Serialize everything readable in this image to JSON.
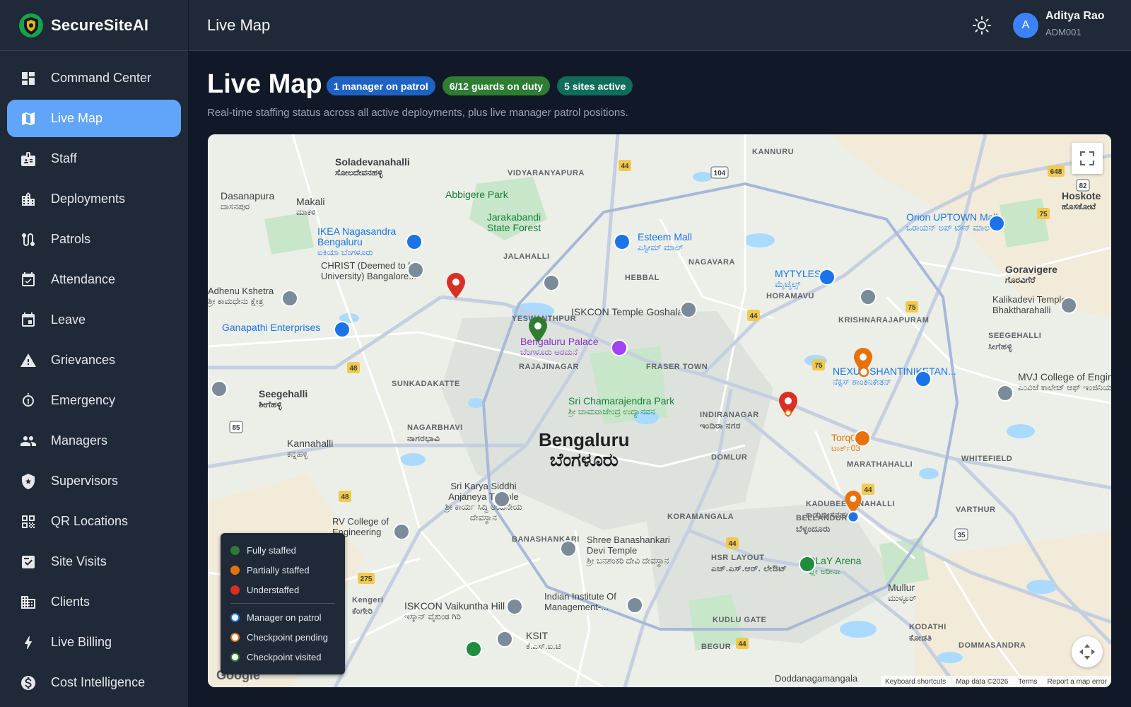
{
  "app": {
    "name": "SecureSiteAI"
  },
  "sidebar": {
    "items": [
      {
        "label": "Command Center",
        "icon": "dashboard-icon"
      },
      {
        "label": "Live Map",
        "icon": "map-icon",
        "active": true
      },
      {
        "label": "Staff",
        "icon": "badge-icon"
      },
      {
        "label": "Deployments",
        "icon": "building-icon"
      },
      {
        "label": "Patrols",
        "icon": "route-icon"
      },
      {
        "label": "Attendance",
        "icon": "calendar-check-icon"
      },
      {
        "label": "Leave",
        "icon": "calendar-icon"
      },
      {
        "label": "Grievances",
        "icon": "warning-icon"
      },
      {
        "label": "Emergency",
        "icon": "alarm-icon"
      },
      {
        "label": "Managers",
        "icon": "people-icon"
      },
      {
        "label": "Supervisors",
        "icon": "shield-star-icon"
      },
      {
        "label": "QR Locations",
        "icon": "qr-code-icon"
      },
      {
        "label": "Site Visits",
        "icon": "checklist-icon"
      },
      {
        "label": "Clients",
        "icon": "corporate-icon"
      },
      {
        "label": "Live Billing",
        "icon": "bolt-icon"
      },
      {
        "label": "Cost Intelligence",
        "icon": "dollar-icon"
      }
    ]
  },
  "topbar": {
    "title": "Live Map",
    "user": {
      "initial": "A",
      "name": "Aditya Rao",
      "id": "ADM001"
    }
  },
  "page": {
    "title": "Live Map",
    "badges": [
      "1 manager on patrol",
      "6/12 guards on duty",
      "5 sites active"
    ],
    "subtitle": "Real-time staffing status across all active deployments, plus live manager patrol positions."
  },
  "map": {
    "city_label": "Bengaluru",
    "city_label_kn": "ಬೆಂಗಳೂರು",
    "places": [
      {
        "en": "Soladevanahalli",
        "kn": "ಸೋಲದೇವನಹಳ್ಳಿ"
      },
      {
        "en": "Dasanapura",
        "kn": "ದಾಸನಪುರ"
      },
      {
        "en": "Makali",
        "kn": "ಮಾಕಳಿ"
      },
      {
        "en": "Abbigere Park"
      },
      {
        "en": "Jarakabandi State Forest"
      },
      {
        "en": "IKEA Nagasandra Bengaluru",
        "kn": "ಐಕಿಯಾ ಬೆಂಗಳೂರು"
      },
      {
        "en": "CHRIST (Deemed to be University) Bangalore..."
      },
      {
        "en": "Esteem Mall",
        "kn": "ಎಸ್ಟೀಮ್ ಮಾಲ್"
      },
      {
        "en": "ISKCON Temple Goshala"
      },
      {
        "en": "MYTYLES",
        "kn": "ಮೈಟೈಲ್ಸ್"
      },
      {
        "en": "Orion UPTOWN Mall",
        "kn": "ಒರಾಯನ್ ಅಪ್ ಟೌನ್ ಮಾಲ್"
      },
      {
        "en": "Goravigere",
        "kn": "ಗೊರವಿಗೆರೆ"
      },
      {
        "en": "Kalikadevi Temple Bhaktharahalli"
      },
      {
        "en": "Ganapathi Enterprises"
      },
      {
        "en": "Bengaluru Palace",
        "kn": "ಬೆಂಗಳೂರು ಅರಮನೆ"
      },
      {
        "en": "SEEGEHALLI",
        "kn": "ಸೀಗೆಹಳ್ಳಿ"
      },
      {
        "en": "NEXUS SHANTINIKETAN...",
        "kn": "ನೆಕ್ಸಸ್ ಶಾಂತಿನಿಕೇತನ್"
      },
      {
        "en": "MVJ College of Engineering",
        "kn": "ಎಂವಿಜೆ ಕಾಲೇಜ್ ಆಫ್ ಇಂಜಿನಿಯರಿಂಗ್"
      },
      {
        "en": "Seegehalli",
        "kn": "ಶೀಗೆಹಳ್ಳಿ"
      },
      {
        "en": "Sri Chamarajendra Park",
        "kn": "ಶ್ರೀ ಚಾಮರಾಜೇಂದ್ರ ಉದ್ಯಾನವನ"
      },
      {
        "en": "INDIRANAGAR",
        "kn": "ಇಂದಿರಾ ನಗರ"
      },
      {
        "en": "Torq03",
        "kn": "ಟಾರ್ಕ್03"
      },
      {
        "en": "NAGARBHAVI",
        "kn": "ನಾಗರಭಾವಿ"
      },
      {
        "en": "Kannahalli",
        "kn": "ಕನ್ನಹಳ್ಳಿ"
      },
      {
        "en": "Sri Karya Siddhi Anjaneya Temple",
        "kn": "ಶ್ರೀ ಕಾರ್ಯ ಸಿದ್ಧಿ ಆಂಜನೇಯ ದೇವಸ್ಥಾನ"
      },
      {
        "en": "RV College of Engineering"
      },
      {
        "en": "KADUBEESANAHALLI",
        "kn": "ಕಾಡುಬೀಸನಹಳ್ಳಿ"
      },
      {
        "en": "BELLANDUR",
        "kn": "ಬೆಳ್ಳಂದೂರು"
      },
      {
        "en": "Shree Banashankari Devi Temple",
        "kn": "ಶ್ರೀ ಬನಶಂಕರಿ ದೇವಿ ದೇವಸ್ಥಾನ"
      },
      {
        "en": "HSR LAYOUT",
        "kn": "ಎಚ್.ಎಸ್.ಆರ್. ಲೇಔಟ್"
      },
      {
        "en": "PLaY Arena",
        "kn": "ಪ್ಲೇ ಅರೀನಾ"
      },
      {
        "en": "Mullur",
        "kn": "ಮುಳ್ಳೂರ್"
      },
      {
        "en": "ISKCON Vaikuntha Hill",
        "kn": "ಇಸ್ಕಾನ್ ವೈಕುಂಠ ಗಿರಿ"
      },
      {
        "en": "Indian Institute Of Management-..."
      },
      {
        "en": "KSIT",
        "kn": "ಕೆ.ಎಸ್.ಐ.ಟಿ"
      },
      {
        "en": "KODATHI",
        "kn": "ಕೋಡತಿ"
      },
      {
        "en": "Doddanagamangala"
      },
      {
        "en": "Hoskote",
        "kn": "ಹೊಸಕೋಟೆ"
      },
      {
        "en": "Kengeri",
        "kn": "ಕೆಂಗೇರಿ"
      },
      {
        "en": "Adhenu Kshetra",
        "kn": "ಶ್ರೀ ಕಾಮಧೇನು ಕ್ಷೇತ್ರ"
      }
    ],
    "area_labels": [
      "VIDYARANYAPURA",
      "JALAHALLI",
      "HEBBAL",
      "NAGAVARA",
      "HORAMAVU",
      "KRISHNARAJAPURAM",
      "YESWANTHPUR",
      "RAJAJINAGAR",
      "FRASER TOWN",
      "SUNKADAKATTE",
      "DOMLUR",
      "MARATHAHALLI",
      "WHITEFIELD",
      "KORAMANGALA",
      "BANASHANKARI",
      "VARTHUR",
      "KUDLU GATE",
      "BEGUR",
      "KANNURU",
      "DOMMASANDRA"
    ],
    "highway_shields": [
      "44",
      "104",
      "648",
      "75",
      "44",
      "75",
      "75",
      "48",
      "85",
      "48",
      "275",
      "44",
      "44",
      "35",
      "44",
      "82"
    ],
    "markers": [
      {
        "status": "Understaffed",
        "color": "#d93025"
      },
      {
        "status": "Fully staffed",
        "color": "#2e7d32"
      },
      {
        "status": "Understaffed",
        "color": "#d93025"
      },
      {
        "status": "Partially staffed",
        "color": "#e8710a"
      },
      {
        "status": "Partially staffed",
        "color": "#e8710a"
      }
    ],
    "manager_marker": {
      "label": "Manager on patrol",
      "color": "#1a73e8"
    },
    "legend": [
      {
        "label": "Fully staffed",
        "color": "#2e7d32",
        "type": "dot"
      },
      {
        "label": "Partially staffed",
        "color": "#e8710a",
        "type": "dot"
      },
      {
        "label": "Understaffed",
        "color": "#d93025",
        "type": "dot"
      },
      {
        "label": "Manager on patrol",
        "color": "#1a73e8",
        "type": "ring"
      },
      {
        "label": "Checkpoint pending",
        "color": "#e8710a",
        "type": "ring"
      },
      {
        "label": "Checkpoint visited",
        "color": "#2e7d32",
        "type": "ring"
      }
    ],
    "google_logo": "Google",
    "attribution": [
      "Keyboard shortcuts",
      "Map data ©2026",
      "Terms",
      "Report a map error"
    ]
  }
}
